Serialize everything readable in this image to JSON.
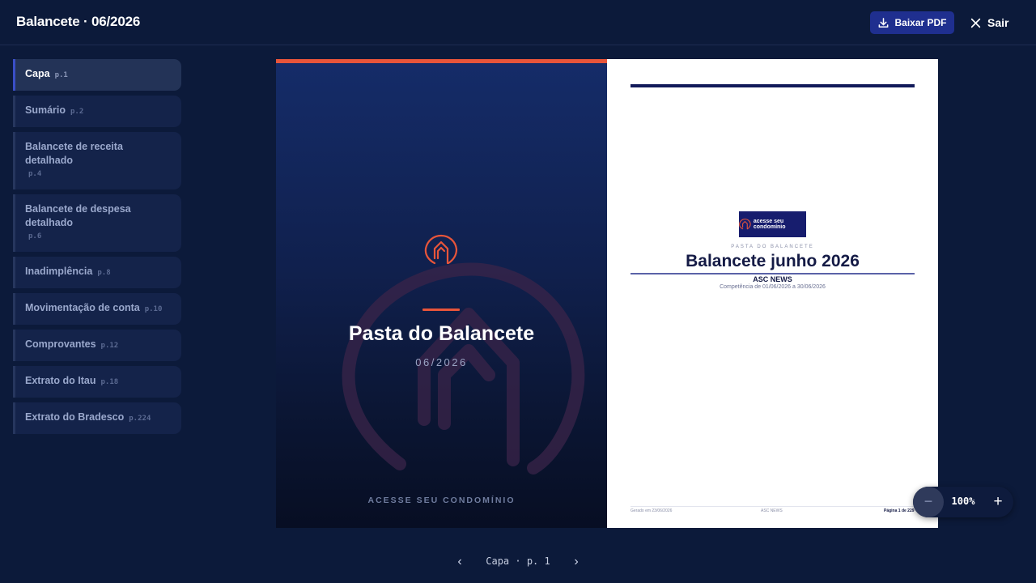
{
  "header": {
    "title": "Balancete · 06/2026",
    "download_label": "Baixar PDF",
    "exit_label": "Sair"
  },
  "sidebar": {
    "items": [
      {
        "label": "Capa",
        "page": "p.1",
        "active": true
      },
      {
        "label": "Sumário",
        "page": "p.2"
      },
      {
        "label": "Balancete de receita detalhado",
        "page": "p.4"
      },
      {
        "label": "Balancete de despesa detalhado",
        "page": "p.6"
      },
      {
        "label": "Inadimplência",
        "page": "p.8"
      },
      {
        "label": "Movimentação de conta",
        "page": "p.10"
      },
      {
        "label": "Comprovantes",
        "page": "p.12"
      },
      {
        "label": "Extrato do Itau",
        "page": "p.18"
      },
      {
        "label": "Extrato do Bradesco",
        "page": "p.224"
      }
    ]
  },
  "cover": {
    "title": "Pasta do Balancete",
    "date": "06/2026",
    "footer": "ACESSE SEU CONDOMÍNIO"
  },
  "document": {
    "brand": "acesse seu condomínio",
    "kicker": "PASTA DO BALANCETE",
    "title": "Balancete junho 2026",
    "org": "ASC NEWS",
    "competence": "Competência de 01/06/2026 a 30/06/2026",
    "footer_left": "Gerado em 23/06/2026",
    "footer_center": "ASC NEWS",
    "footer_right": "Página 1 de 229"
  },
  "pager": {
    "prev": "‹",
    "label": "Capa · p. 1",
    "next": "›"
  },
  "zoom": {
    "minus": "−",
    "value": "100%",
    "plus": "+"
  },
  "colors": {
    "background": "#0c1a3a",
    "accent": "#e8553a",
    "button": "#1f2f8f",
    "active_border": "#3a4fc7"
  },
  "icons": {
    "download": "download-icon",
    "close": "close-icon",
    "logo": "house-logo-icon"
  }
}
